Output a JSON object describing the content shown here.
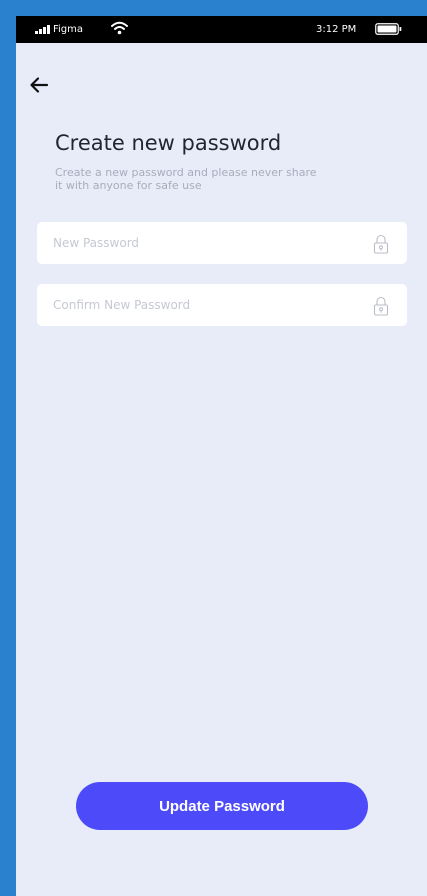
{
  "status_bar": {
    "carrier": "Figma",
    "time": "3:12 PM",
    "icons": [
      "signal-icon",
      "wifi-icon",
      "battery-icon"
    ]
  },
  "header": {
    "back_icon": "back-arrow-icon"
  },
  "page": {
    "title": "Create new password",
    "subtitle": "Create a new password and please never share it with anyone for safe use"
  },
  "form": {
    "new_password": {
      "placeholder": "New Password",
      "value": "",
      "icon": "lock-icon"
    },
    "confirm_password": {
      "placeholder": "Confirm New Password",
      "value": "",
      "icon": "lock-icon"
    }
  },
  "actions": {
    "update_label": "Update Password"
  },
  "colors": {
    "background": "#e7ecf8",
    "frame": "#2a82cf",
    "accent": "#4d4afa",
    "title_text": "#1f2533",
    "muted_text": "#a7adbc"
  }
}
